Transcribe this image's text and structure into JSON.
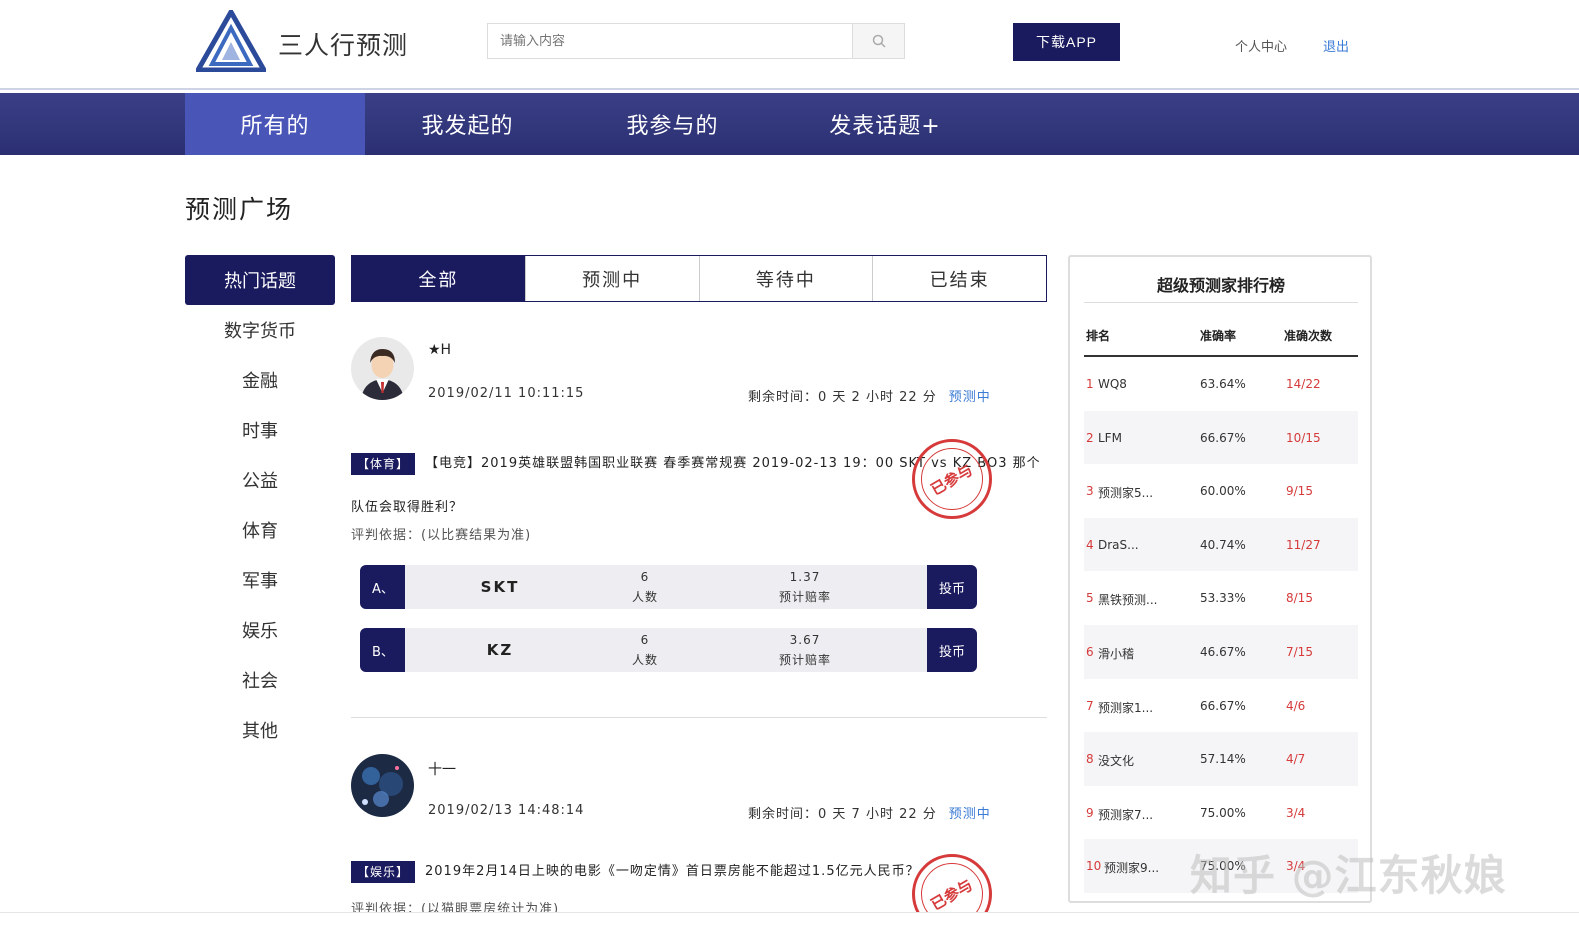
{
  "header": {
    "brand": "三人行预测",
    "search_placeholder": "请输入内容",
    "download_label": "下载APP",
    "user_center": "个人中心",
    "logout": "退出"
  },
  "nav": [
    "所有的",
    "我发起的",
    "我参与的",
    "发表话题+"
  ],
  "page_title": "预测广场",
  "categories": [
    "热门话题",
    "数字货币",
    "金融",
    "时事",
    "公益",
    "体育",
    "军事",
    "娱乐",
    "社会",
    "其他"
  ],
  "tabs": [
    "全部",
    "预测中",
    "等待中",
    "已结束"
  ],
  "posts": [
    {
      "user": "★H",
      "time": "2019/02/11 10:11:15",
      "remain": "剩余时间：0 天 2 小时 22 分",
      "status": "预测中",
      "tag": "【体育】",
      "text": "【电竞】2019英雄联盟韩国职业联赛 春季赛常规赛 2019-02-13 19：00 SKT vs KZ BO3 那个队伍会取得胜利？",
      "basis": "评判依据：(以比赛结果为准)",
      "stamp": "已参与",
      "options": [
        {
          "letter": "A、",
          "team": "SKT",
          "count": "6",
          "count_label": "人数",
          "odds": "1.37",
          "odds_label": "预计赔率",
          "vote": "投币"
        },
        {
          "letter": "B、",
          "team": "KZ",
          "count": "6",
          "count_label": "人数",
          "odds": "3.67",
          "odds_label": "预计赔率",
          "vote": "投币"
        }
      ]
    },
    {
      "user": "十一",
      "time": "2019/02/13 14:48:14",
      "remain": "剩余时间：0 天 7 小时 22 分",
      "status": "预测中",
      "tag": "【娱乐】",
      "text": "2019年2月14日上映的电影《一吻定情》首日票房能不能超过1.5亿元人民币？",
      "basis": "评判依据：(以猫眼票房统计为准)",
      "stamp": "已参与"
    }
  ],
  "ranking": {
    "title": "超级预测家排行榜",
    "headers": [
      "排名",
      "准确率",
      "准确次数"
    ],
    "rows": [
      {
        "rank": "1",
        "name": "WQ8",
        "acc": "63.64%",
        "count": "14/22"
      },
      {
        "rank": "2",
        "name": "LFM",
        "acc": "66.67%",
        "count": "10/15"
      },
      {
        "rank": "3",
        "name": "预测家5...",
        "acc": "60.00%",
        "count": "9/15"
      },
      {
        "rank": "4",
        "name": "DraS...",
        "acc": "40.74%",
        "count": "11/27"
      },
      {
        "rank": "5",
        "name": "黑铁预测...",
        "acc": "53.33%",
        "count": "8/15"
      },
      {
        "rank": "6",
        "name": "滑小稽",
        "acc": "46.67%",
        "count": "7/15"
      },
      {
        "rank": "7",
        "name": "预测家1...",
        "acc": "66.67%",
        "count": "4/6"
      },
      {
        "rank": "8",
        "name": "没文化",
        "acc": "57.14%",
        "count": "4/7"
      },
      {
        "rank": "9",
        "name": "预测家7...",
        "acc": "75.00%",
        "count": "3/4"
      },
      {
        "rank": "10",
        "name": "预测家9...",
        "acc": "75.00%",
        "count": "3/4"
      }
    ]
  },
  "watermark": "知乎 @江东秋娘",
  "colors": {
    "primary": "#1a1a5e",
    "nav": "#2f3378",
    "nav_active": "#4a55b8",
    "accent_red": "#d63a3a",
    "link_blue": "#3a7bd5"
  }
}
